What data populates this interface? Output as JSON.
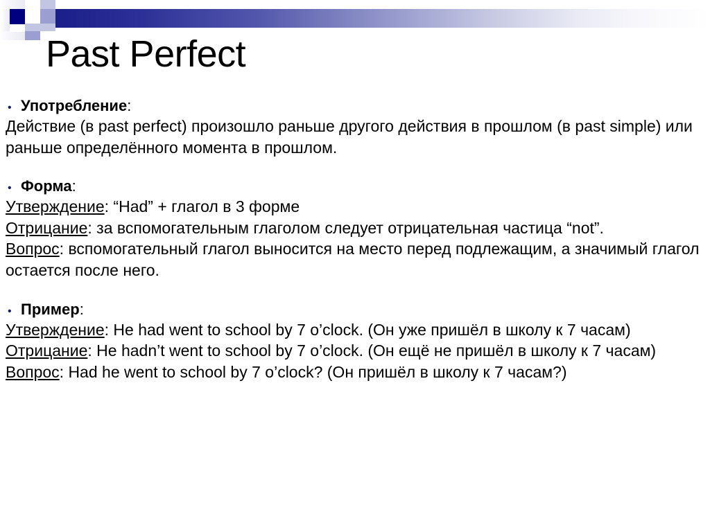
{
  "slide": {
    "title": "Past Perfect",
    "bullet_glyph": "•",
    "colon": ":",
    "accent_color": "#000080",
    "bullet_color": "#1a1a66",
    "text_color": "#000000",
    "background_color": "#ffffff"
  },
  "sections": [
    {
      "label": "Употребление",
      "lines": [
        {
          "underlined": "",
          "text": "Действие (в past perfect) произошло раньше другого действия в прошлом (в past simple) или раньше определённого момента в прошлом."
        }
      ]
    },
    {
      "label": "Форма",
      "lines": [
        {
          "underlined": "Утверждение",
          "text": ": “Had” + глагол в 3 форме"
        },
        {
          "underlined": "Отрицание",
          "text": ": за вспомогательным глаголом следует отрицательная частица “not”."
        },
        {
          "underlined": "Вопрос",
          "text": ": вспомогательный глагол выносится на место перед подлежащим, а значимый глагол остается после него."
        }
      ]
    },
    {
      "label": "Пример",
      "lines": [
        {
          "underlined": "Утверждение",
          "text": ": He had went to school by 7 o’clock. (Он уже пришёл в школу к 7 часам)"
        },
        {
          "underlined": "Отрицание",
          "text": ": He hadn’t went to school by 7 o’clock. (Он ещё не пришёл в школу к 7 часам)"
        },
        {
          "underlined": "Вопрос",
          "text": ": Had he went to school by 7 o’clock? (Он пришёл в школу к 7 часам?)"
        }
      ]
    }
  ]
}
